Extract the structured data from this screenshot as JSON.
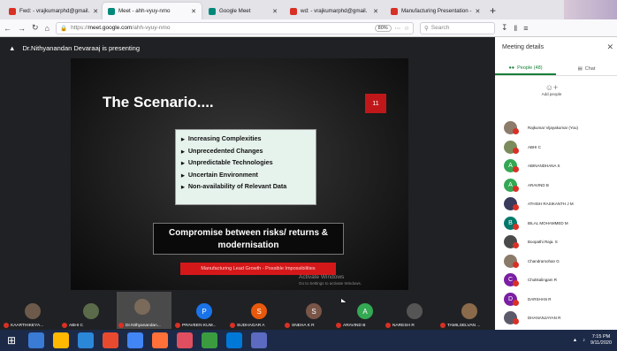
{
  "browser": {
    "tabs": [
      {
        "title": "Fwd: - vrajkumarphd@gmail.",
        "favicon_color": "#d93025",
        "active": false
      },
      {
        "title": "Meet - ahh-vyuy-nmo",
        "favicon_color": "#00897b",
        "active": true
      },
      {
        "title": "Google Meet",
        "favicon_color": "#00897b",
        "active": false
      },
      {
        "title": "wd: - vrajkumarphd@gmail.",
        "favicon_color": "#d93025",
        "active": false
      },
      {
        "title": "Manufacturing Presentation -",
        "favicon_color": "#d93025",
        "active": false
      }
    ],
    "url_prefix": "https://",
    "url_host": "meet.google.com",
    "url_path": "/ahh-vyuy-nmo",
    "zoom": "80%",
    "search_placeholder": "Search"
  },
  "meet": {
    "presenting_text": "Dr.Nithyanandan Devaraaj is presenting",
    "slide": {
      "title": "The Scenario....",
      "number": "11",
      "bullets": [
        "Increasing Complexities",
        "Unprecedented Changes",
        "Unpredictable Technologies",
        "Uncertain Environment",
        "Non-availability of Relevant Data"
      ],
      "callout_line1": "Compromise between risks/ returns &",
      "callout_line2": "modernisation",
      "footer_bar": "Manufacturing Lead Growth - Possible Impossibilities",
      "watermark_line1": "Activate Windows",
      "watermark_line2": "Go to Settings to activate Windows."
    },
    "tiles": [
      {
        "name": "KAARTHIKEYA...",
        "initial": "",
        "color": "#6d5a4a"
      },
      {
        "name": "ABHI C",
        "initial": "",
        "color": "#5b6b4a"
      },
      {
        "name": "Dr.Nithyanandan...",
        "initial": "",
        "color": "#7a6a5a",
        "selected": true
      },
      {
        "name": "PRAVEEN KUM...",
        "initial": "P",
        "color": "#1a73e8"
      },
      {
        "name": "SUDHAGAR A",
        "initial": "S",
        "color": "#e8590c"
      },
      {
        "name": "SNEHA K R",
        "initial": "S",
        "color": "#795548"
      },
      {
        "name": "ARAVIND B",
        "initial": "A",
        "color": "#34a853"
      },
      {
        "name": "NARESH R",
        "initial": "",
        "color": "#555555"
      },
      {
        "name": "TAMILSELVAN ...",
        "initial": "",
        "color": "#8a6a4a"
      }
    ]
  },
  "panel": {
    "title": "Meeting details",
    "people_tab": "People (48)",
    "chat_tab": "Chat",
    "add_people": "Add people",
    "participants": [
      {
        "name": "Rajkumar Vijayakumar (You)",
        "initial": "",
        "color": "#8d7b6b"
      },
      {
        "name": "ABHI C",
        "initial": "",
        "color": "#7b8b5b"
      },
      {
        "name": "ABINANDHANA S",
        "initial": "A",
        "color": "#34a853"
      },
      {
        "name": "ARAVIND B",
        "initial": "A",
        "color": "#34a853"
      },
      {
        "name": "ATHISH RASIKANTH J M",
        "initial": "",
        "color": "#3a3a5a"
      },
      {
        "name": "BILAL MOHAMMED M",
        "initial": "B",
        "color": "#00796b"
      },
      {
        "name": "Boopathi Raja. S",
        "initial": "",
        "color": "#4a4a4a"
      },
      {
        "name": "Chandramohan G",
        "initial": "",
        "color": "#8a7a6a"
      },
      {
        "name": "Chokkalingam R",
        "initial": "C",
        "color": "#7b1fa2"
      },
      {
        "name": "DARSHAN R",
        "initial": "D",
        "color": "#7b1fa2"
      },
      {
        "name": "DHANANJAYAN R",
        "initial": "",
        "color": "#5a5a6a"
      }
    ]
  },
  "taskbar": {
    "time": "7:15 PM",
    "date": "9/11/2020",
    "apps": [
      "#3a7bd5",
      "#ffb900",
      "#2b88d8",
      "#e84a2f",
      "#4285f4",
      "#ff7139",
      "#e04f5f",
      "#3b9c3f",
      "#0078d7",
      "#5c6bc0"
    ]
  }
}
